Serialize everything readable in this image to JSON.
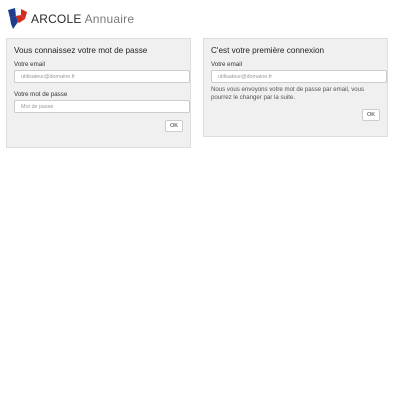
{
  "header": {
    "brand_name": "ARCOLE",
    "brand_sub": "Annuaire",
    "logo_icon": "marianne-flag-logo"
  },
  "colors": {
    "flag_blue": "#1f3d8c",
    "flag_red": "#d52b1e",
    "panel_bg": "#f0f0f0"
  },
  "login_panel": {
    "title": "Vous connaissez votre mot de passe",
    "email_label": "Votre email",
    "email_placeholder": "utilisateur@domaine.fr",
    "password_label": "Votre mot de passe",
    "password_placeholder": "Mot de passe",
    "ok_label": "OK"
  },
  "first_login_panel": {
    "title": "C'est votre première connexion",
    "email_label": "Votre email",
    "email_placeholder": "utilisateur@domaine.fr",
    "help_text": "Nous vous envoyons votre mot de passe par email, vous pourrez le changer par la suite.",
    "ok_label": "OK"
  }
}
